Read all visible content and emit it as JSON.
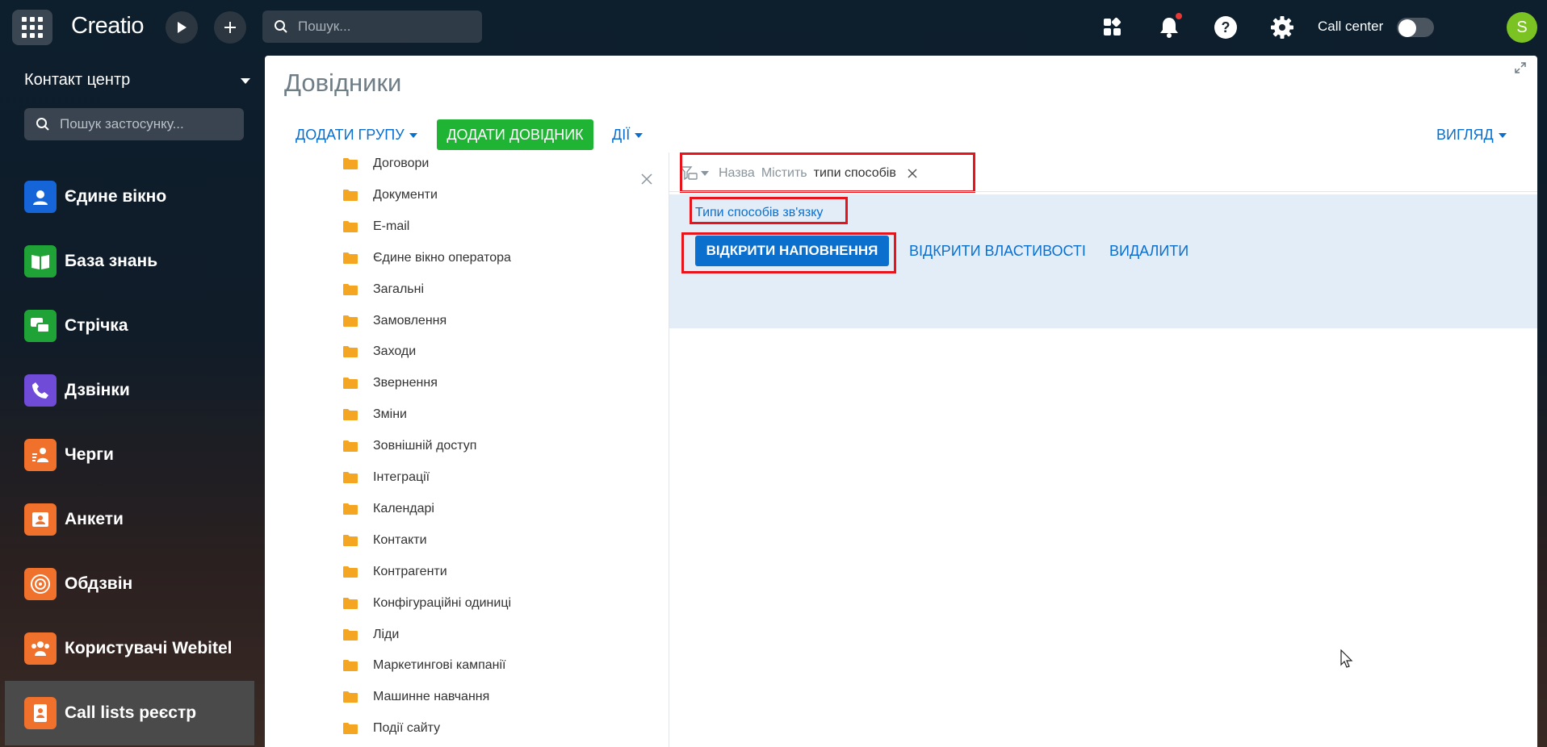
{
  "topbar": {
    "logo": "Creatio",
    "search_placeholder": "Пошук...",
    "call_center_label": "Call center",
    "avatar_letter": "S",
    "icons": [
      "apps-grid-icon",
      "play-icon",
      "plus-icon",
      "search-icon",
      "widgets-icon",
      "bell-icon",
      "help-icon",
      "gear-icon"
    ]
  },
  "sidebar": {
    "workplace": "Контакт центр",
    "search_placeholder": "Пошук застосунку...",
    "items": [
      {
        "label": "Єдине вікно",
        "color": "#1565d8"
      },
      {
        "label": "База знань",
        "color": "#1fa336"
      },
      {
        "label": "Стрічка",
        "color": "#1fa336"
      },
      {
        "label": "Дзвінки",
        "color": "#6f4bd8"
      },
      {
        "label": "Черги",
        "color": "#f0712c"
      },
      {
        "label": "Анкети",
        "color": "#f0712c"
      },
      {
        "label": "Обдзвін",
        "color": "#f0712c"
      },
      {
        "label": "Користувачі Webitel",
        "color": "#f0712c"
      },
      {
        "label": "Call lists реєстр",
        "color": "#f0712c"
      }
    ]
  },
  "main": {
    "title": "Довідники",
    "toolbar": {
      "add_group": "ДОДАТИ ГРУПУ",
      "add_lookup": "ДОДАТИ ДОВІДНИК",
      "actions": "ДІЇ",
      "view": "ВИГЛЯД"
    },
    "tree": [
      "Договори",
      "Документи",
      "E-mail",
      "Єдине вікно оператора",
      "Загальні",
      "Замовлення",
      "Заходи",
      "Звернення",
      "Зміни",
      "Зовнішній доступ",
      "Інтеграції",
      "Календарі",
      "Контакти",
      "Контрагенти",
      "Конфігураційні одиниці",
      "Ліди",
      "Маркетингові кампанії",
      "Машинне навчання",
      "Події сайту"
    ],
    "filter": {
      "column": "Назва",
      "operator": "Містить",
      "value": "типи способів"
    },
    "result": {
      "title": "Типи способів зв'язку",
      "open_content": "ВІДКРИТИ НАПОВНЕННЯ",
      "open_properties": "ВІДКРИТИ ВЛАСТИВОСТІ",
      "delete": "ВИДАЛИТИ"
    }
  },
  "colors": {
    "accent_blue": "#0b6fce",
    "green": "#20b434",
    "highlight": "#e8141c",
    "folder": "#f4a623"
  }
}
